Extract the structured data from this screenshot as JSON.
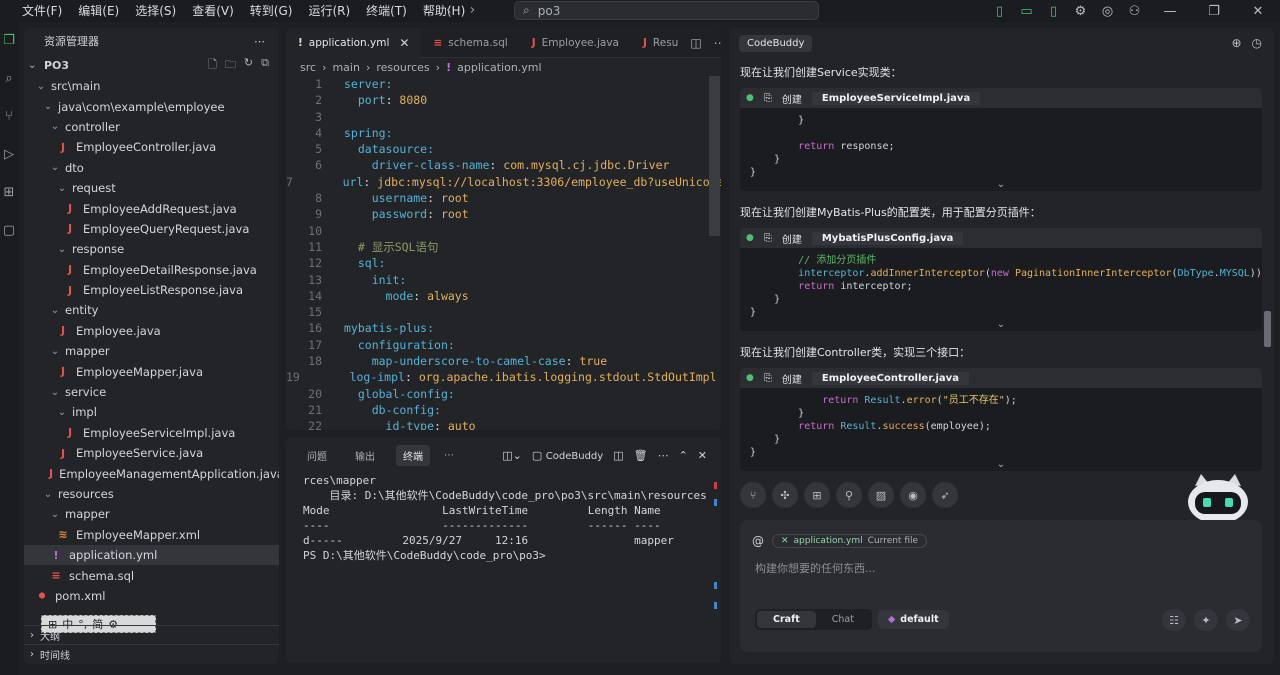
{
  "menu": [
    "文件(F)",
    "编辑(E)",
    "选择(S)",
    "查看(V)",
    "转到(G)",
    "运行(R)",
    "终端(T)",
    "帮助(H)"
  ],
  "search": {
    "value": "po3"
  },
  "icons": {
    "back": "arrow-left-icon",
    "forward": "arrow-right-icon",
    "search": "search-icon"
  },
  "explorer": {
    "title": "资源管理器",
    "project": "PO3",
    "tree": [
      {
        "label": "src\\main",
        "indent": 1,
        "type": "folder",
        "open": true
      },
      {
        "label": "java\\com\\example\\employee",
        "indent": 2,
        "type": "folder",
        "open": true
      },
      {
        "label": "controller",
        "indent": 3,
        "type": "folder",
        "open": true
      },
      {
        "label": "EmployeeController.java",
        "indent": 4,
        "type": "java"
      },
      {
        "label": "dto",
        "indent": 3,
        "type": "folder",
        "open": true
      },
      {
        "label": "request",
        "indent": 4,
        "type": "folder",
        "open": true
      },
      {
        "label": "EmployeeAddRequest.java",
        "indent": 5,
        "type": "java"
      },
      {
        "label": "EmployeeQueryRequest.java",
        "indent": 5,
        "type": "java"
      },
      {
        "label": "response",
        "indent": 4,
        "type": "folder",
        "open": true
      },
      {
        "label": "EmployeeDetailResponse.java",
        "indent": 5,
        "type": "java"
      },
      {
        "label": "EmployeeListResponse.java",
        "indent": 5,
        "type": "java"
      },
      {
        "label": "entity",
        "indent": 3,
        "type": "folder",
        "open": true
      },
      {
        "label": "Employee.java",
        "indent": 4,
        "type": "java"
      },
      {
        "label": "mapper",
        "indent": 3,
        "type": "folder",
        "open": true
      },
      {
        "label": "EmployeeMapper.java",
        "indent": 4,
        "type": "java"
      },
      {
        "label": "service",
        "indent": 3,
        "type": "folder",
        "open": true
      },
      {
        "label": "impl",
        "indent": 4,
        "type": "folder",
        "open": true
      },
      {
        "label": "EmployeeServiceImpl.java",
        "indent": 5,
        "type": "java"
      },
      {
        "label": "EmployeeService.java",
        "indent": 4,
        "type": "java"
      },
      {
        "label": "EmployeeManagementApplication.java",
        "indent": 3,
        "type": "java"
      },
      {
        "label": "resources",
        "indent": 2,
        "type": "folder",
        "open": true
      },
      {
        "label": "mapper",
        "indent": 3,
        "type": "folder",
        "open": true
      },
      {
        "label": "EmployeeMapper.xml",
        "indent": 4,
        "type": "xml"
      },
      {
        "label": "application.yml",
        "indent": 3,
        "type": "yml",
        "active": true
      },
      {
        "label": "schema.sql",
        "indent": 3,
        "type": "sql"
      },
      {
        "label": "pom.xml",
        "indent": 1,
        "type": "pom"
      }
    ],
    "ime": [
      "中",
      "°,",
      "简",
      "⚙"
    ],
    "outline": "大纲",
    "timeline": "时间线"
  },
  "editor": {
    "tabs": [
      {
        "label": "application.yml",
        "active": true,
        "icon": "!"
      },
      {
        "label": "schema.sql",
        "active": false,
        "icon": "≡"
      },
      {
        "label": "Employee.java",
        "active": false,
        "icon": "J"
      },
      {
        "label": "Resu",
        "active": false,
        "icon": "J"
      }
    ],
    "breadcrumb": [
      "src",
      "main",
      "resources",
      "application.yml"
    ],
    "lines": [
      [
        [
          "k",
          "server:"
        ]
      ],
      [
        [
          "p",
          "  "
        ],
        [
          "k",
          "port"
        ],
        [
          "p",
          ": "
        ],
        [
          "v",
          "8080"
        ]
      ],
      [],
      [
        [
          "k",
          "spring:"
        ]
      ],
      [
        [
          "p",
          "  "
        ],
        [
          "k",
          "datasource:"
        ]
      ],
      [
        [
          "p",
          "    "
        ],
        [
          "k",
          "driver-class-name"
        ],
        [
          "p",
          ": "
        ],
        [
          "v",
          "com.mysql.cj.jdbc.Driver"
        ]
      ],
      [
        [
          "p",
          "    "
        ],
        [
          "k",
          "url"
        ],
        [
          "p",
          ": "
        ],
        [
          "v",
          "jdbc:mysql://localhost:3306/employee_db?useUnicode"
        ]
      ],
      [
        [
          "p",
          "    "
        ],
        [
          "k",
          "username"
        ],
        [
          "p",
          ": "
        ],
        [
          "v",
          "root"
        ]
      ],
      [
        [
          "p",
          "    "
        ],
        [
          "k",
          "password"
        ],
        [
          "p",
          ": "
        ],
        [
          "v",
          "root"
        ]
      ],
      [],
      [
        [
          "p",
          "  "
        ],
        [
          "c",
          "# 显示SQL语句"
        ]
      ],
      [
        [
          "p",
          "  "
        ],
        [
          "k",
          "sql:"
        ]
      ],
      [
        [
          "p",
          "    "
        ],
        [
          "k",
          "init:"
        ]
      ],
      [
        [
          "p",
          "      "
        ],
        [
          "k",
          "mode"
        ],
        [
          "p",
          ": "
        ],
        [
          "v",
          "always"
        ]
      ],
      [],
      [
        [
          "k",
          "mybatis-plus:"
        ]
      ],
      [
        [
          "p",
          "  "
        ],
        [
          "k",
          "configuration:"
        ]
      ],
      [
        [
          "p",
          "    "
        ],
        [
          "k",
          "map-underscore-to-camel-case"
        ],
        [
          "p",
          ": "
        ],
        [
          "v",
          "true"
        ]
      ],
      [
        [
          "p",
          "    "
        ],
        [
          "k",
          "log-impl"
        ],
        [
          "p",
          ": "
        ],
        [
          "v",
          "org.apache.ibatis.logging.stdout.StdOutImpl"
        ]
      ],
      [
        [
          "p",
          "  "
        ],
        [
          "k",
          "global-config:"
        ]
      ],
      [
        [
          "p",
          "    "
        ],
        [
          "k",
          "db-config:"
        ]
      ],
      [
        [
          "p",
          "      "
        ],
        [
          "k",
          "id-type"
        ],
        [
          "p",
          ": "
        ],
        [
          "v",
          "auto"
        ]
      ]
    ]
  },
  "terminal": {
    "tabs": [
      "问题",
      "输出",
      "终端"
    ],
    "active_tab": "终端",
    "panel_name": "CodeBuddy",
    "lines": [
      "rces\\mapper",
      "",
      "",
      "    目录: D:\\其他软件\\CodeBuddy\\code_pro\\po3\\src\\main\\resources",
      "",
      "",
      "Mode                 LastWriteTime         Length Name",
      "----                 -------------         ------ ----",
      "d-----         2025/9/27     12:16                mapper",
      "",
      "",
      "",
      "PS D:\\其他软件\\CodeBuddy\\code_pro\\po3> "
    ]
  },
  "buddy": {
    "title": "CodeBuddy",
    "messages": [
      {
        "text": "现在让我们创建Service实现类：",
        "action": "创建",
        "file": "EmployeeServiceImpl.java",
        "code": [
          [
            [
              "p",
              "        }"
            ]
          ],
          [],
          [
            [
              "p",
              "        "
            ],
            [
              "kw",
              "return"
            ],
            [
              "p",
              " response;"
            ]
          ],
          [
            [
              "p",
              "    }"
            ]
          ],
          [
            [
              "p",
              "}"
            ]
          ]
        ]
      },
      {
        "text": "现在让我们创建MyBatis-Plus的配置类，用于配置分页插件：",
        "action": "创建",
        "file": "MybatisPlusConfig.java",
        "code": [
          [
            [
              "cm",
              "        // 添加分页插件"
            ]
          ],
          [
            [
              "p",
              "        "
            ],
            [
              "cls",
              "interceptor"
            ],
            [
              "p",
              "."
            ],
            [
              "fn",
              "addInnerInterceptor"
            ],
            [
              "p",
              "("
            ],
            [
              "kw",
              "new"
            ],
            [
              "p",
              " "
            ],
            [
              "fn",
              "PaginationInnerInterceptor"
            ],
            [
              "p",
              "("
            ],
            [
              "cls",
              "DbType"
            ],
            [
              "p",
              "."
            ],
            [
              "cls",
              "MYSQL"
            ],
            [
              "p",
              "));"
            ]
          ],
          [
            [
              "p",
              "        "
            ],
            [
              "kw",
              "return"
            ],
            [
              "p",
              " interceptor;"
            ]
          ],
          [
            [
              "p",
              "    }"
            ]
          ],
          [
            [
              "p",
              "}"
            ]
          ]
        ]
      },
      {
        "text": "现在让我们创建Controller类，实现三个接口：",
        "action": "创建",
        "file": "EmployeeController.java",
        "code": [
          [
            [
              "p",
              "            "
            ],
            [
              "kw",
              "return"
            ],
            [
              "p",
              " "
            ],
            [
              "cls",
              "Result"
            ],
            [
              "p",
              "."
            ],
            [
              "fn",
              "error"
            ],
            [
              "p",
              "("
            ],
            [
              "str",
              "\"员工不存在\""
            ],
            [
              "p",
              ");"
            ]
          ],
          [
            [
              "p",
              "        }"
            ]
          ],
          [
            [
              "p",
              "        "
            ],
            [
              "kw",
              "return"
            ],
            [
              "p",
              " "
            ],
            [
              "cls",
              "Result"
            ],
            [
              "p",
              "."
            ],
            [
              "fn",
              "success"
            ],
            [
              "p",
              "(employee);"
            ]
          ],
          [
            [
              "p",
              "    }"
            ]
          ],
          [
            [
              "p",
              "}"
            ]
          ]
        ]
      }
    ],
    "context_file": "application.yml",
    "context_tag": "Current file",
    "placeholder": "构建你想要的任何东西...",
    "modes": [
      "Craft",
      "Chat"
    ],
    "active_mode": "Craft",
    "model": "default"
  }
}
